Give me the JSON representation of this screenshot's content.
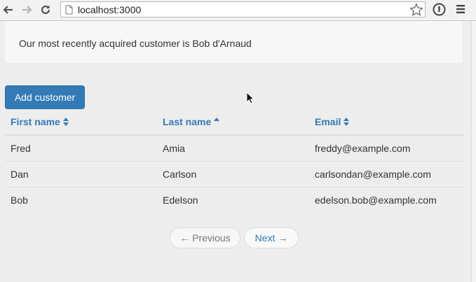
{
  "browser": {
    "url": "localhost:3000",
    "icons": {
      "back": "back-arrow-icon",
      "forward": "forward-arrow-icon",
      "reload": "reload-icon",
      "page": "page-icon",
      "bookmark": "star-icon",
      "extension": "info-circle-icon",
      "menu": "hamburger-menu-icon"
    }
  },
  "page": {
    "announcement": "Our most recently acquired customer is Bob d'Arnaud",
    "add_button_label": "Add customer",
    "table": {
      "headers": [
        "First name",
        "Last name",
        "Email"
      ],
      "sort_state": [
        "unsorted",
        "ascending",
        "unsorted"
      ],
      "rows": [
        [
          "Fred",
          "Amia",
          "freddy@example.com"
        ],
        [
          "Dan",
          "Carlson",
          "carlsondan@example.com"
        ],
        [
          "Bob",
          "Edelson",
          "edelson.bob@example.com"
        ]
      ]
    },
    "pagination": {
      "previous_label": "← Previous",
      "next_label": "Next →"
    }
  },
  "colors": {
    "primary": "#337ab7",
    "page_background": "#ededed",
    "jumbotron": "#f7f7f7"
  }
}
